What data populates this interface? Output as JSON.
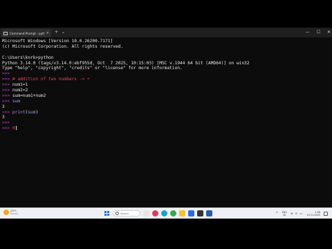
{
  "window": {
    "tab_title": "Command Prompt - python",
    "tab_close": "×",
    "new_tab": "+",
    "dropdown": "⌄",
    "minimize": "—",
    "maximize": "☐",
    "close": "✕"
  },
  "console": {
    "lines": [
      {
        "segments": [
          {
            "text": "Microsoft Windows [Version 10.0.26200.7171]",
            "cls": "out"
          }
        ]
      },
      {
        "segments": [
          {
            "text": "(c) Microsoft Corporation. All rights reserved.",
            "cls": "out"
          }
        ]
      },
      {
        "segments": [
          {
            "text": "",
            "cls": "out"
          }
        ]
      },
      {
        "segments": [
          {
            "text": "C:\\Users\\knrk>python",
            "cls": "out"
          }
        ]
      },
      {
        "segments": [
          {
            "text": "Python 3.14.0 (tags/v3.14.0:ebf955d, Oct  7 2025, 10:15:03) [MSC v.1944 64 bit (AMD64)] on win32",
            "cls": "out"
          }
        ]
      },
      {
        "segments": [
          {
            "text": "Type \"help\", \"copyright\", \"credits\" or \"license\" for more information.",
            "cls": "out"
          }
        ]
      },
      {
        "segments": [
          {
            "text": ">>>",
            "cls": "p"
          }
        ]
      },
      {
        "segments": [
          {
            "text": ">>> ",
            "cls": "p"
          },
          {
            "text": "# addition of two numbers -> +",
            "cls": "cmt"
          }
        ]
      },
      {
        "segments": [
          {
            "text": ">>> ",
            "cls": "p"
          },
          {
            "text": "num1=1",
            "cls": "out"
          }
        ]
      },
      {
        "segments": [
          {
            "text": ">>> ",
            "cls": "p"
          },
          {
            "text": "num2=2",
            "cls": "out"
          }
        ]
      },
      {
        "segments": [
          {
            "text": ">>> ",
            "cls": "p"
          },
          {
            "text": "sum=num1+num2",
            "cls": "out"
          }
        ]
      },
      {
        "segments": [
          {
            "text": ">>> ",
            "cls": "p"
          },
          {
            "text": "sum",
            "cls": "code"
          }
        ]
      },
      {
        "segments": [
          {
            "text": "3",
            "cls": "out"
          }
        ]
      },
      {
        "segments": [
          {
            "text": ">>> ",
            "cls": "p"
          },
          {
            "text": "print",
            "cls": "fn"
          },
          {
            "text": "(",
            "cls": "out"
          },
          {
            "text": "sum",
            "cls": "code"
          },
          {
            "text": ")",
            "cls": "out"
          }
        ]
      },
      {
        "segments": [
          {
            "text": "3",
            "cls": "out"
          }
        ]
      },
      {
        "segments": [
          {
            "text": ">>>",
            "cls": "p"
          }
        ]
      },
      {
        "segments": [
          {
            "text": ">>> ",
            "cls": "p"
          },
          {
            "text": "0",
            "cls": "cmt"
          }
        ],
        "cursor": true
      }
    ]
  },
  "taskbar": {
    "weather_temp": "29°C",
    "weather_desc": "Sunny",
    "search_placeholder": "Search",
    "tray_chevron": "^",
    "lang_1": "ENG",
    "lang_2": "IN",
    "sys_icons": "◔ ⚟ ▭",
    "time": "1:06",
    "date": "10-11-2025"
  },
  "colors": {
    "prompt": "#c13ad2",
    "comment": "#e5484d",
    "variable": "#8fa8ff",
    "function": "#b97fd9"
  }
}
